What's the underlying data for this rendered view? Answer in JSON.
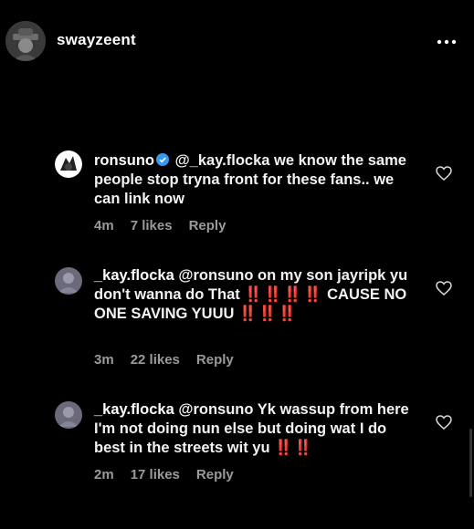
{
  "header": {
    "username": "swayzeent",
    "avatar_icon": "avatar-icon",
    "more_icon": "more-horizontal-icon"
  },
  "comments": [
    {
      "username": "ronsuno",
      "verified": true,
      "mention": "@_kay.flocka",
      "text": "we know the same people stop tryna front for these fans.. we can link now",
      "time": "4m",
      "likes": "7 likes",
      "reply": "Reply"
    },
    {
      "username": "_kay.flocka",
      "verified": false,
      "mention": "@ronsuno",
      "text_part1": "on my son jayripk yu don't wanna do That",
      "bangs_a": "‼️‼️‼️‼️",
      "text_part2": "CAUSE NO ONE SAVING YUUU",
      "bangs_b": "‼️‼️‼️",
      "time": "3m",
      "likes": "22 likes",
      "reply": "Reply"
    },
    {
      "username": "_kay.flocka",
      "verified": false,
      "mention": "@ronsuno",
      "text": "Yk wassup from here I'm not doing nun else but doing wat I do best in the streets wit yu",
      "bangs": "‼️‼️",
      "time": "2m",
      "likes": "17 likes",
      "reply": "Reply"
    }
  ],
  "colors": {
    "background": "#000000",
    "text": "#ffffff",
    "meta": "#9a9a9a",
    "verified": "#3897f0",
    "bangs": "#e0222e"
  }
}
